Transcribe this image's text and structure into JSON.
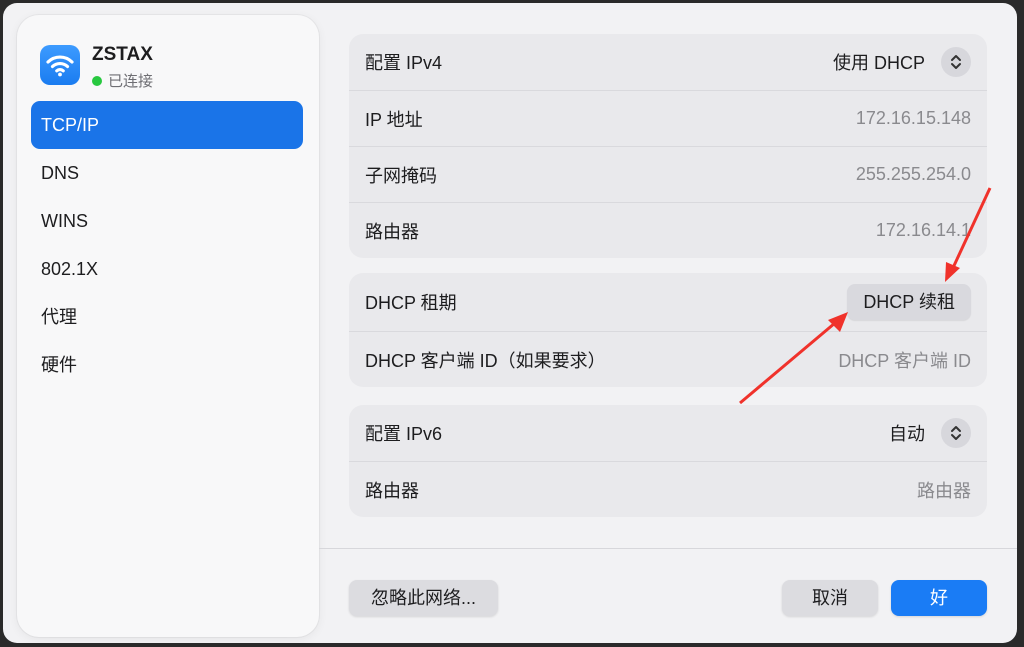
{
  "network": {
    "name": "ZSTAX",
    "status": "已连接"
  },
  "sidebar": {
    "items": [
      {
        "label": "TCP/IP",
        "active": true
      },
      {
        "label": "DNS"
      },
      {
        "label": "WINS"
      },
      {
        "label": "802.1X"
      },
      {
        "label": "代理"
      },
      {
        "label": "硬件"
      }
    ]
  },
  "ipv4": {
    "config_label": "配置 IPv4",
    "config_value": "使用 DHCP",
    "ip_label": "IP 地址",
    "ip_value": "172.16.15.148",
    "subnet_label": "子网掩码",
    "subnet_value": "255.255.254.0",
    "router_label": "路由器",
    "router_value": "172.16.14.1"
  },
  "dhcp": {
    "lease_label": "DHCP 租期",
    "renew_button": "DHCP 续租",
    "client_id_label": "DHCP 客户端 ID（如果要求）",
    "client_id_placeholder": "DHCP 客户端 ID"
  },
  "ipv6": {
    "config_label": "配置 IPv6",
    "config_value": "自动",
    "router_label": "路由器",
    "router_placeholder": "路由器"
  },
  "footer": {
    "forget_button": "忽略此网络...",
    "cancel_button": "取消",
    "ok_button": "好"
  },
  "colors": {
    "accent": "#1a74e8",
    "annotation": "#f0322b",
    "connected": "#28c840"
  }
}
